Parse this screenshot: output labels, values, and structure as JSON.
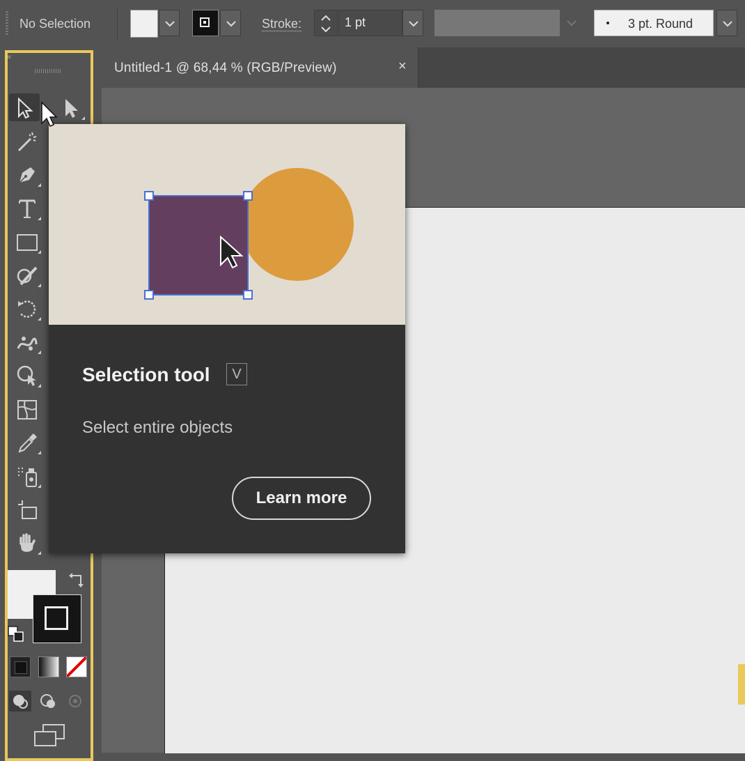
{
  "control_bar": {
    "selection_status": "No Selection",
    "stroke_label": "Stroke:",
    "stroke_weight": "1 pt",
    "brush_profile": "3 pt. Round"
  },
  "document_tab": {
    "title": "Untitled-1 @ 68,44 % (RGB/Preview)",
    "close_glyph": "×"
  },
  "toolbar": {
    "collapse_glyph": "«",
    "tools": [
      "selection-tool",
      "direct-selection-tool",
      "magic-wand-tool",
      "pen-tool",
      "type-tool",
      "rectangle-tool",
      "shaper-tool",
      "rotate-tool",
      "puppet-warp-tool",
      "shape-builder-tool",
      "mesh-tool",
      "eyedropper-tool",
      "symbol-sprayer-tool",
      "artboard-tool",
      "hand-tool"
    ]
  },
  "tooltip": {
    "title": "Selection tool",
    "shortcut": "V",
    "description": "Select entire objects",
    "button_label": "Learn more",
    "illustration_colors": {
      "background": "#e2dbd0",
      "square": "#633e5f",
      "circle": "#dc9b3c",
      "selection": "#4a6fd1"
    }
  },
  "colors": {
    "highlight": "#e8c95a",
    "panel": "#535353",
    "artboard": "#ebebeb"
  }
}
